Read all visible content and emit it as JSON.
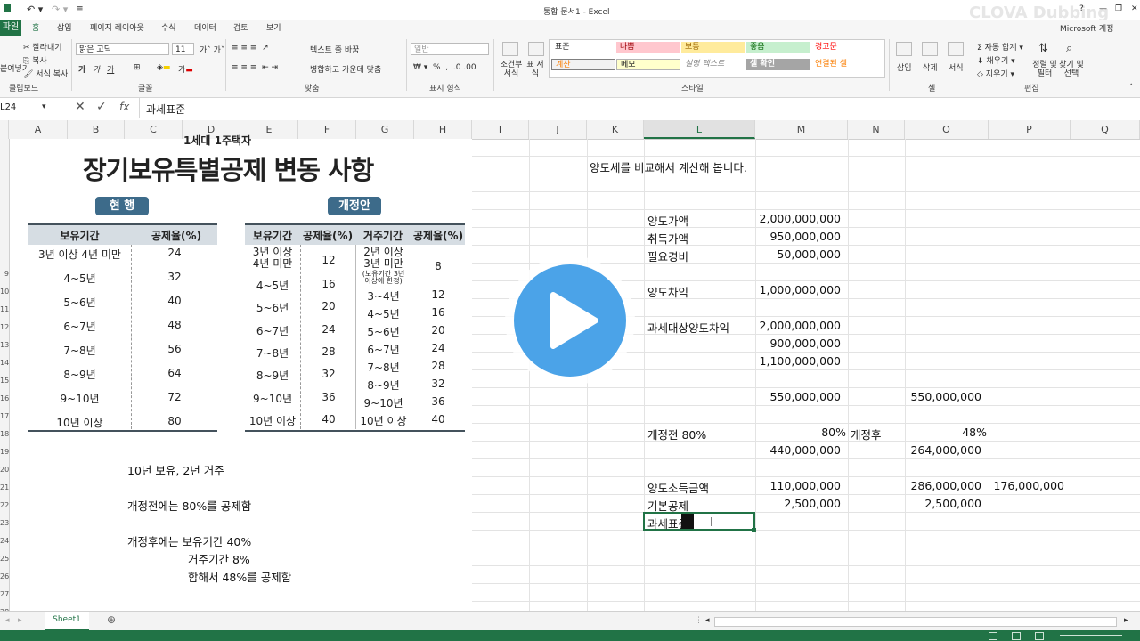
{
  "window": {
    "title": "통합 문서1 - Excel",
    "account": "Microsoft 계정",
    "watermark": "CLOVA Dubbing"
  },
  "ribbon": {
    "file_tab": "파일",
    "tabs": [
      "홈",
      "삽입",
      "페이지 레이아웃",
      "수식",
      "데이터",
      "검토",
      "보기"
    ],
    "clipboard": {
      "cut": "잘라내기",
      "copy": "복사",
      "format_painter": "서식 복사",
      "paste": "붙여넣기",
      "label": "클립보드"
    },
    "font": {
      "name": "맑은 고딕",
      "size": "11",
      "label": "글꼴"
    },
    "align": {
      "wrap": "텍스트 줄 바꿈",
      "merge": "병합하고 가운데 맞춤",
      "label": "맞춤"
    },
    "number": {
      "format": "일반",
      "label": "표시 형식"
    },
    "styles": {
      "cond_format": "조건부 서식",
      "table_format": "표 서식",
      "cells": [
        "표준",
        "나쁨",
        "보통",
        "좋음",
        "경고문",
        "계산",
        "메모",
        "설명 텍스트",
        "셀 확인",
        "연결된 셀"
      ],
      "label": "스타일"
    },
    "cells_group": {
      "insert": "삽입",
      "delete": "삭제",
      "format": "서식",
      "label": "셀"
    },
    "editing": {
      "autosum": "자동 합계",
      "fill": "채우기",
      "clear": "지우기",
      "sort": "정렬 및 필터",
      "find": "찾기 및 선택",
      "label": "편집"
    }
  },
  "formula_bar": {
    "name_box": "L24",
    "content": "과세표준",
    "fx": "fx"
  },
  "columns": [
    "A",
    "B",
    "C",
    "D",
    "E",
    "F",
    "G",
    "H",
    "I",
    "J",
    "K",
    "L",
    "M",
    "N",
    "O",
    "P",
    "Q"
  ],
  "rows": [
    "",
    "",
    "",
    "",
    "",
    "",
    "",
    "9",
    "10",
    "11",
    "12",
    "13",
    "14",
    "15",
    "16",
    "17",
    "18",
    "19",
    "20",
    "21",
    "22",
    "23",
    "24",
    "25",
    "26",
    "27",
    "28"
  ],
  "image": {
    "subtitle_cut": "1세대 1주택자",
    "title": "장기보유특별공제 변동 사항",
    "current": {
      "label": "현    행",
      "head": [
        "보유기간",
        "공제율(%)"
      ],
      "rows": [
        [
          "3년 이상 4년 미만",
          "24"
        ],
        [
          "4~5년",
          "32"
        ],
        [
          "5~6년",
          "40"
        ],
        [
          "6~7년",
          "48"
        ],
        [
          "7~8년",
          "56"
        ],
        [
          "8~9년",
          "64"
        ],
        [
          "9~10년",
          "72"
        ],
        [
          "10년 이상",
          "80"
        ]
      ]
    },
    "proposed": {
      "label": "개정안",
      "head": [
        "보유기간",
        "공제율(%)",
        "거주기간",
        "공제율(%)"
      ],
      "hold": [
        [
          "3년 이상\n4년 미만",
          "12"
        ],
        [
          "4~5년",
          "16"
        ],
        [
          "5~6년",
          "20"
        ],
        [
          "6~7년",
          "24"
        ],
        [
          "7~8년",
          "28"
        ],
        [
          "8~9년",
          "32"
        ],
        [
          "9~10년",
          "36"
        ],
        [
          "10년 이상",
          "40"
        ]
      ],
      "live_first": "2년 이상\n3년 미만",
      "live_first_note": "(보유기간 3년\n이상에 한정)",
      "live_first_rate": "8",
      "live": [
        [
          "3~4년",
          "12"
        ],
        [
          "4~5년",
          "16"
        ],
        [
          "5~6년",
          "20"
        ],
        [
          "6~7년",
          "24"
        ],
        [
          "7~8년",
          "28"
        ],
        [
          "8~9년",
          "32"
        ],
        [
          "9~10년",
          "36"
        ],
        [
          "10년 이상",
          "40"
        ]
      ]
    }
  },
  "sheet": {
    "intro": "양도세를 비교해서 계산해 봅니다.",
    "labels": {
      "sale": "양도가액",
      "acquire": "취득가액",
      "expense": "필요경비",
      "gain": "양도차익",
      "taxable_gain": "과세대상양도차익",
      "before": "개정전 80%",
      "after": "개정후",
      "income": "양도소득금액",
      "basic": "기본공제",
      "base": "과세표준"
    },
    "values": {
      "sale": "2,000,000,000",
      "acquire": "950,000,000",
      "expense": "50,000,000",
      "gain": "1,000,000,000",
      "taxable1": "2,000,000,000",
      "taxable2": "900,000,000",
      "taxable3": "1,100,000,000",
      "half_m": "550,000,000",
      "half_o": "550,000,000",
      "rate_before": "80%",
      "rate_after": "48%",
      "ded_m": "440,000,000",
      "ded_o": "264,000,000",
      "income_m": "110,000,000",
      "income_o": "286,000,000",
      "income_p": "176,000,000",
      "basic_m": "2,500,000",
      "basic_o": "2,500,000"
    },
    "notes": {
      "n1": "10년 보유, 2년 거주",
      "n2": "개정전에는 80%를 공제함",
      "n3": "개정후에는 보유기간 40%",
      "n4": "거주기간 8%",
      "n5": "합해서 48%를 공제함"
    }
  },
  "sheet_tab": "Sheet1"
}
